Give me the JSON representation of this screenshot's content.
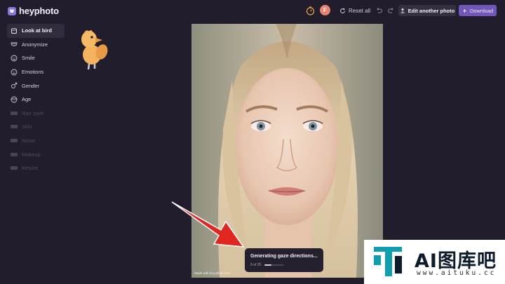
{
  "app": {
    "name": "heyphoto"
  },
  "header": {
    "avatar_initial": "F",
    "reset_label": "Reset all",
    "edit_label": "Edit another photo",
    "download_label": "Download"
  },
  "sidebar": {
    "items": [
      {
        "label": "Look at bird",
        "icon": "bird-icon",
        "state": "active"
      },
      {
        "label": "Anonymize",
        "icon": "mask-icon",
        "state": "enabled"
      },
      {
        "label": "Smile",
        "icon": "smile-icon",
        "state": "enabled"
      },
      {
        "label": "Emotions",
        "icon": "emotion-icon",
        "state": "enabled"
      },
      {
        "label": "Gender",
        "icon": "gender-icon",
        "state": "enabled"
      },
      {
        "label": "Age",
        "icon": "age-icon",
        "state": "enabled"
      },
      {
        "label": "Hair style",
        "icon": "pill-icon",
        "state": "disabled"
      },
      {
        "label": "Skin",
        "icon": "pill-icon",
        "state": "disabled"
      },
      {
        "label": "Noise",
        "icon": "pill-icon",
        "state": "disabled"
      },
      {
        "label": "Makeup",
        "icon": "pill-icon",
        "state": "disabled"
      },
      {
        "label": "Resize",
        "icon": "pill-icon",
        "state": "disabled"
      }
    ]
  },
  "photo": {
    "watermark": "Made with hey-photo.com"
  },
  "toast": {
    "title": "Generating gaze directions...",
    "count_text": "9 of 25",
    "progress": 0.36
  },
  "brand_badge": {
    "name": "AI图库吧",
    "url": "www.aituku.cc"
  },
  "colors": {
    "background": "#211d2c",
    "accent": "#6f58b9",
    "arrow": "#e0261f",
    "brand": "#0f9db0"
  }
}
